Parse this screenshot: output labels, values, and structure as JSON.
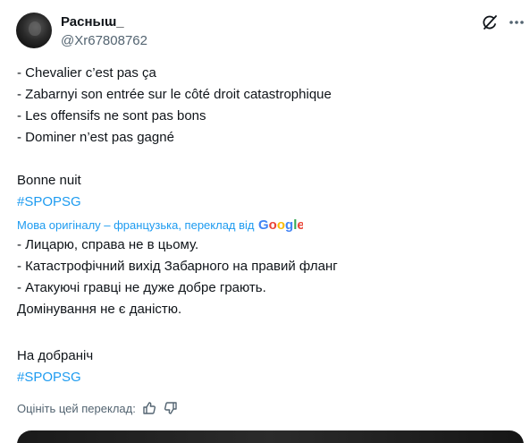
{
  "author": {
    "display_name": "Расньıɯ_",
    "handle": "@Xr67808762"
  },
  "icons": {
    "grok": "grok-icon",
    "more": "more-options-icon",
    "like": "thumbs-up-icon",
    "dislike": "thumbs-down-icon"
  },
  "original": {
    "lines": [
      "- Chevalier c’est pas ça",
      "- Zabarnyi son entrée sur le côté droit catastrophique",
      "- Les offensifs ne sont pas bons",
      "- Dominer n’est pas gagné"
    ],
    "signoff": "Bonne nuit",
    "hashtag": "#SPOPSG"
  },
  "translation": {
    "source_note": "Мова оригіналу – французька, переклад від",
    "provider": "Google",
    "lines": [
      "- Лицарю, справа не в цьому.",
      "- Катастрофічний вихід Забарного на правий фланг",
      "- Атакуючі гравці не дуже добре грають.",
      "Домінування не є даністю."
    ],
    "signoff": "На добраніч",
    "hashtag": "#SPOPSG"
  },
  "rating": {
    "label": "Оцініть цей переклад:"
  },
  "colors": {
    "link": "#1d9bf0",
    "text": "#0f1419",
    "secondary": "#536471"
  }
}
